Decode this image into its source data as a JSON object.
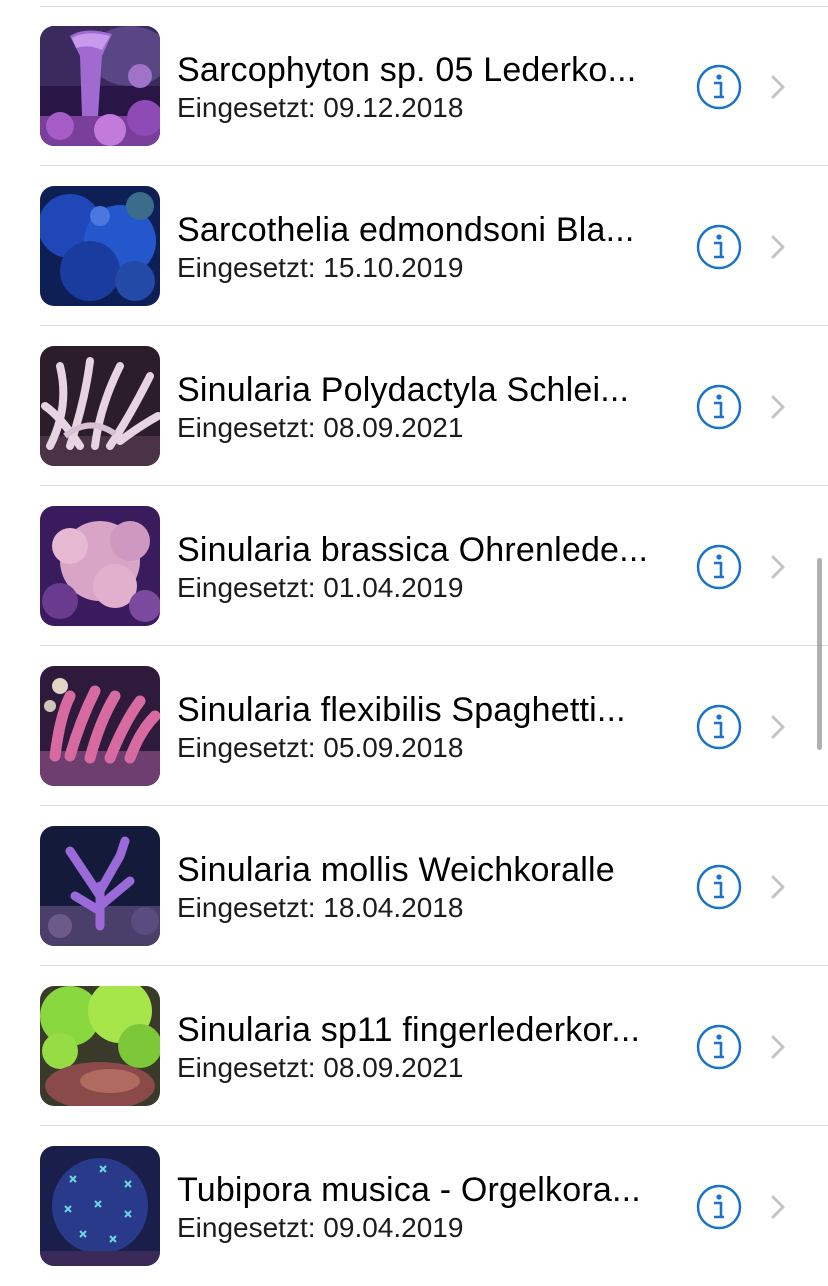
{
  "list": {
    "items": [
      {
        "title": "Sarcophyton sp. 05 Lederko...",
        "subtitle": "Eingesetzt: 09.12.2018"
      },
      {
        "title": "Sarcothelia edmondsoni Bla...",
        "subtitle": "Eingesetzt: 15.10.2019"
      },
      {
        "title": "Sinularia Polydactyla Schlei...",
        "subtitle": "Eingesetzt: 08.09.2021"
      },
      {
        "title": "Sinularia brassica Ohrenlede...",
        "subtitle": "Eingesetzt: 01.04.2019"
      },
      {
        "title": "Sinularia flexibilis Spaghetti...",
        "subtitle": "Eingesetzt: 05.09.2018"
      },
      {
        "title": "Sinularia mollis Weichkoralle",
        "subtitle": "Eingesetzt: 18.04.2018"
      },
      {
        "title": "Sinularia sp11 fingerlederkor...",
        "subtitle": "Eingesetzt: 08.09.2021"
      },
      {
        "title": "Tubipora musica - Orgelkora...",
        "subtitle": "Eingesetzt: 09.04.2019"
      }
    ]
  },
  "colors": {
    "accent": "#1a73c9",
    "chevron": "#c4c4c7",
    "divider": "#d9d9dc"
  },
  "icons": {
    "info": "info-circle-icon",
    "chevron": "chevron-right-icon"
  }
}
